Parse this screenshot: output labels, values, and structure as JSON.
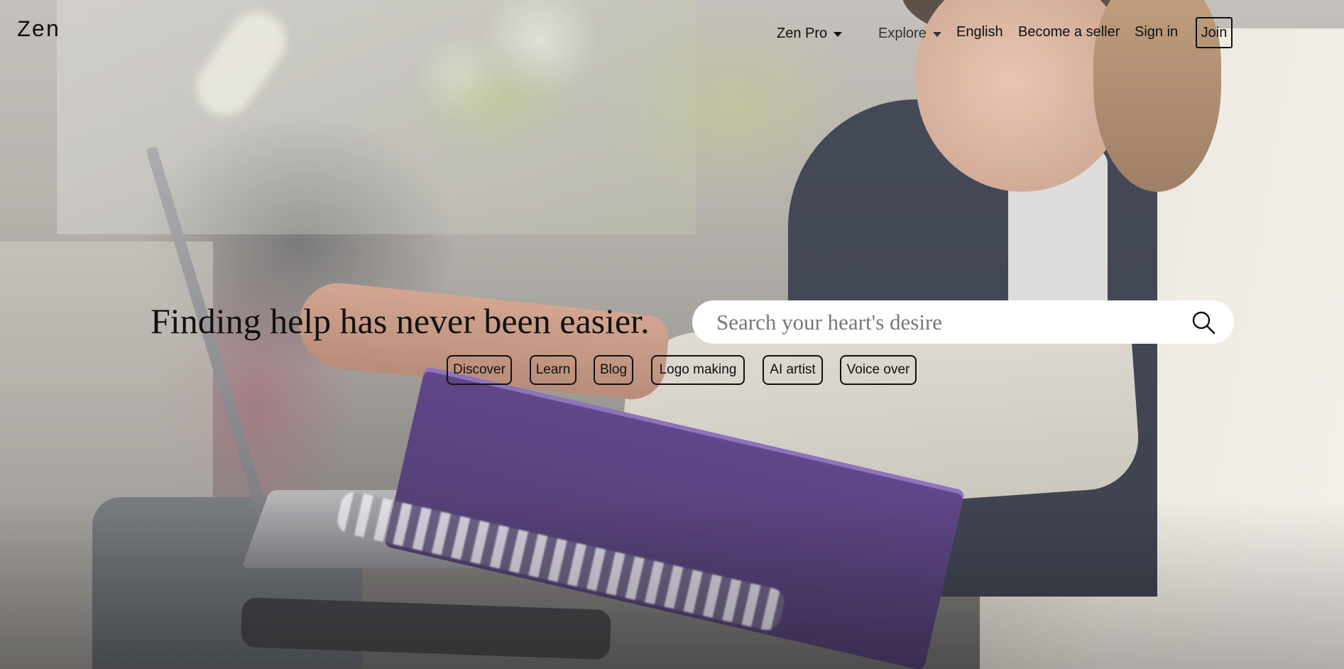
{
  "brand": {
    "logo": "Zen"
  },
  "nav": {
    "zen_pro": "Zen Pro",
    "explore": "Explore",
    "language": "English",
    "become_seller": "Become a seller",
    "sign_in": "Sign in",
    "join": "Join"
  },
  "hero": {
    "headline": "Finding help has never been easier.",
    "search": {
      "placeholder": "Search your heart's desire",
      "value": ""
    },
    "tags": [
      "Discover",
      "Learn",
      "Blog",
      "Logo making",
      "AI artist",
      "Voice over"
    ]
  },
  "icons": {
    "search": "search-icon",
    "dropdown": "caret-down-icon"
  },
  "colors": {
    "text": "#111111",
    "search_bg": "#ffffff"
  }
}
